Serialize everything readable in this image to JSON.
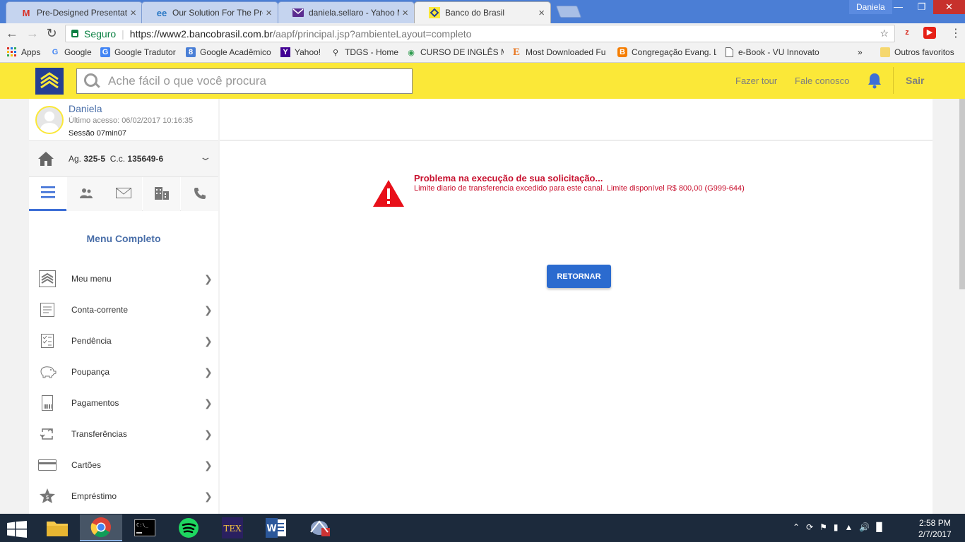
{
  "browser": {
    "tabs": [
      {
        "title": "Pre-Designed Presentatio",
        "icon": "gmail-icon",
        "active": false
      },
      {
        "title": "Our Solution For The Pro",
        "icon": "ee-icon",
        "active": false
      },
      {
        "title": "daniela.sellaro - Yahoo M",
        "icon": "yahoo-mail-icon",
        "active": false
      },
      {
        "title": "Banco do Brasil",
        "icon": "bb-icon",
        "active": true
      }
    ],
    "profile": "Daniela",
    "secure_label": "Seguro",
    "url_host": "https://www2.bancobrasil.com.br",
    "url_path": "/aapf/principal.jsp?ambienteLayout=completo",
    "bookmarks": [
      {
        "label": "Apps",
        "icon": "apps-grid-icon"
      },
      {
        "label": "Google",
        "icon": "google-icon"
      },
      {
        "label": "Google Tradutor",
        "icon": "google-translate-icon"
      },
      {
        "label": "Google Acadêmico",
        "icon": "google-scholar-icon"
      },
      {
        "label": "Yahoo!",
        "icon": "yahoo-icon"
      },
      {
        "label": "TDGS - Home",
        "icon": "search-icon"
      },
      {
        "label": "CURSO DE INGLÊS MA",
        "icon": "globe-icon"
      },
      {
        "label": "Most Downloaded Fu",
        "icon": "elsevier-icon"
      },
      {
        "label": "Congregação Evang. L",
        "icon": "blogger-icon"
      },
      {
        "label": "e-Book - VU Innovato",
        "icon": "page-icon"
      }
    ],
    "bookmarks_overflow": "»",
    "other_bookmarks": "Outros favoritos"
  },
  "bb": {
    "search_placeholder": "Ache fácil o que você procura",
    "tour": "Fazer tour",
    "contact": "Fale conosco",
    "logout": "Sair"
  },
  "user": {
    "name": "Daniela",
    "last_access": "Último acesso: 06/02/2017 10:16:35",
    "session": "Sessão 07min07"
  },
  "account": {
    "agency_label": "Ag.",
    "agency": "325-5",
    "account_label": "C.c.",
    "account": "135649-6"
  },
  "menu": {
    "title": "Menu Completo",
    "items": [
      {
        "label": "Meu menu",
        "icon": "bb-logo-icon"
      },
      {
        "label": "Conta-corrente",
        "icon": "statement-icon"
      },
      {
        "label": "Pendência",
        "icon": "checklist-icon"
      },
      {
        "label": "Poupança",
        "icon": "piggy-bank-icon"
      },
      {
        "label": "Pagamentos",
        "icon": "barcode-icon"
      },
      {
        "label": "Transferências",
        "icon": "transfer-icon"
      },
      {
        "label": "Cartões",
        "icon": "card-icon"
      },
      {
        "label": "Empréstimo",
        "icon": "star-money-icon"
      }
    ]
  },
  "error": {
    "title": "Problema na execução de sua solicitação...",
    "message": "Limite diario de transferencia excedido para este canal. Limite disponível R$ 800,00 (G999-644)",
    "button": "RETORNAR"
  },
  "taskbar": {
    "time": "2:58 PM",
    "date": "2/7/2017"
  },
  "colors": {
    "bb_yellow": "#fbe838",
    "bb_blue": "#243e93",
    "error_red": "#c8102e",
    "button_blue": "#2b6bcf"
  }
}
